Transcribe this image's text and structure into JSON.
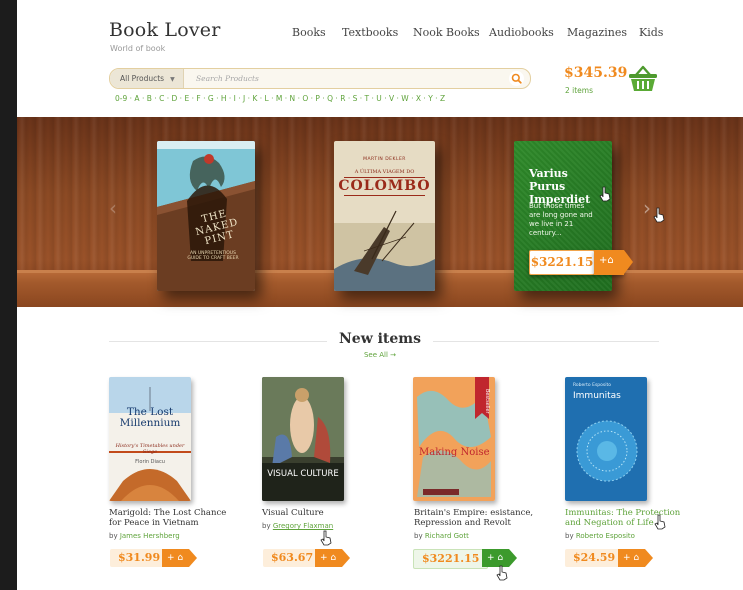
{
  "header": {
    "logo": "Book Lover",
    "tagline": "World of book",
    "nav": [
      "Books",
      "Textbooks",
      "Nook Books",
      "Audiobooks",
      "Magazines",
      "Kids"
    ]
  },
  "search": {
    "category": "All Products",
    "placeholder": "Search Products"
  },
  "alphabet": [
    "0-9",
    "A",
    "B",
    "C",
    "D",
    "E",
    "F",
    "G",
    "H",
    "I",
    "J",
    "K",
    "L",
    "M",
    "N",
    "O",
    "P",
    "Q",
    "R",
    "S",
    "T",
    "U",
    "V",
    "W",
    "X",
    "Y",
    "Z"
  ],
  "cart": {
    "total": "$345.39",
    "items": "2 items"
  },
  "featured": {
    "books": [
      {
        "cover_title": "THE NAKED PINT",
        "cover_subtitle": "AN UNPRETENTIOUS GUIDE TO CRAFT BEER",
        "icon": "book-cover-naked-pint"
      },
      {
        "cover_author": "MARTIN DEKLER",
        "cover_kicker": "A ÚLTIMA VIAGEM DO",
        "cover_title": "COLOMBO",
        "icon": "book-cover-colombo"
      },
      {
        "title": "Varius Purus Imperdiet",
        "blurb": "But those times are long gone and we live in 21 century...",
        "price": "$3221.15"
      }
    ]
  },
  "new_items": {
    "title": "New items",
    "see_all": "See All →",
    "items": [
      {
        "title": "Marigold: The Lost Chance for Peace in Vietnam",
        "by": "by",
        "author": "James Hershberg",
        "price": "$31.99",
        "cart_label": "+",
        "cover_title": "The Lost Millennium",
        "cover_subtitle": "History's Timetables under Siege",
        "cover_author": "Florin Diacu"
      },
      {
        "title": "Visual Culture",
        "by": "by",
        "author": "Gregory Flaxman",
        "price": "$63.67",
        "cart_label": "+",
        "cover_title": "VISUAL CULTURE"
      },
      {
        "title": "Britain's Empire: esistance, Repression and Revolt",
        "by": "by",
        "author": "Richard Gott",
        "price": "$3221.15",
        "cart_label": "+",
        "cover_title": "Making Noise",
        "cover_ribbon": "Bestseller"
      },
      {
        "title": "Immunitas: The Protection and Negation of Life",
        "by": "by",
        "author": "Roberto Esposito",
        "price": "$24.59",
        "cart_label": "+",
        "cover_title": "Immunitas",
        "cover_author": "Roberto Esposito"
      }
    ]
  },
  "colors": {
    "accent_orange": "#f08a1f",
    "accent_green": "#5fa33b",
    "wood": "#8c4a24"
  }
}
